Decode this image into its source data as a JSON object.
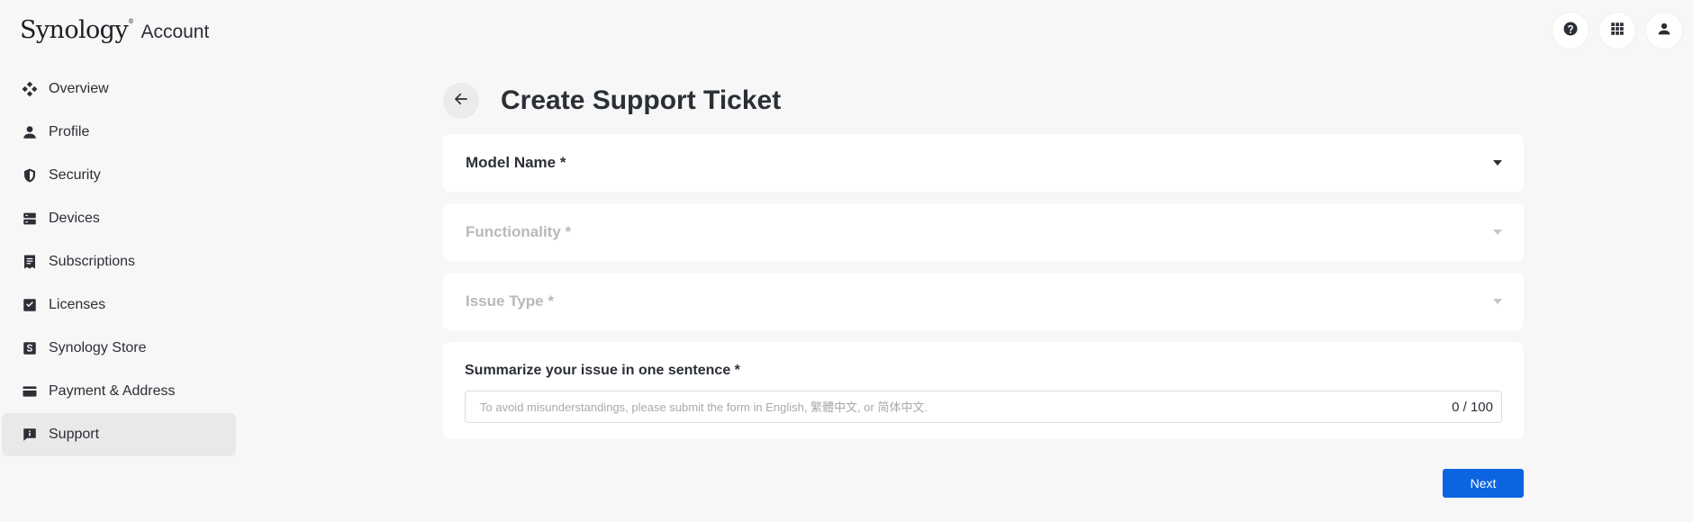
{
  "header": {
    "brand": "Synology",
    "brand_mark": "®",
    "product": "Account",
    "actions": [
      {
        "name": "help",
        "icon": "help-icon"
      },
      {
        "name": "apps",
        "icon": "apps-grid-icon"
      },
      {
        "name": "user",
        "icon": "user-icon"
      }
    ]
  },
  "sidebar": {
    "items": [
      {
        "label": "Overview",
        "icon": "overview-icon",
        "active": false
      },
      {
        "label": "Profile",
        "icon": "person-icon",
        "active": false
      },
      {
        "label": "Security",
        "icon": "shield-icon",
        "active": false
      },
      {
        "label": "Devices",
        "icon": "server-icon",
        "active": false
      },
      {
        "label": "Subscriptions",
        "icon": "receipt-icon",
        "active": false
      },
      {
        "label": "Licenses",
        "icon": "license-icon",
        "active": false
      },
      {
        "label": "Synology Store",
        "icon": "store-icon",
        "active": false
      },
      {
        "label": "Payment & Address",
        "icon": "credit-card-icon",
        "active": false
      },
      {
        "label": "Support",
        "icon": "support-icon",
        "active": true
      }
    ]
  },
  "main": {
    "title": "Create Support Ticket",
    "fields": {
      "model_name": {
        "label": "Model Name *",
        "disabled": false
      },
      "functionality": {
        "label": "Functionality *",
        "disabled": true
      },
      "issue_type": {
        "label": "Issue Type *",
        "disabled": true
      }
    },
    "summary": {
      "label": "Summarize your issue in one sentence *",
      "placeholder": "To avoid misunderstandings, please submit the form in English, 繁體中文, or 简体中文.",
      "value": "",
      "counter": "0 / 100"
    },
    "next_label": "Next"
  },
  "colors": {
    "background": "#f7f7f7",
    "accent": "#0b64e0",
    "text": "#2b2f36",
    "disabled_text": "#b7b9bc"
  }
}
